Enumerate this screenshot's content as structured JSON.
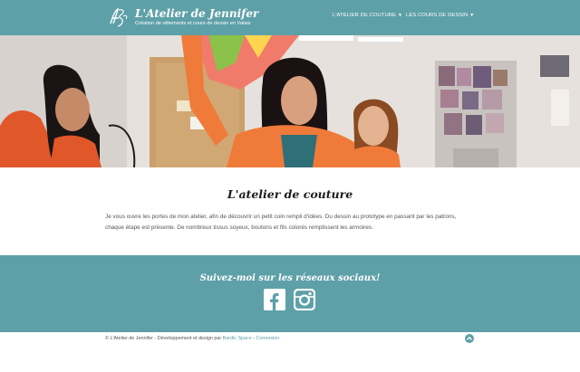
{
  "header": {
    "title": "L'Atelier de Jennifer",
    "tagline": "Création de vêtements et cours de dessin en Valais",
    "logo_icon": "monogram-logo-icon",
    "nav": [
      {
        "label": "L'ATELIER DE COUTURE",
        "icon": "caret-down-icon"
      },
      {
        "label": "LES COURS DE DESSIN",
        "icon": "caret-down-icon"
      }
    ]
  },
  "main": {
    "title": "L'atelier de couture",
    "paragraph": "Je vous ouvre les portes de mon atelier, afin de découvrir un petit coin rempli d'idées. Du dessin au prototype en passant par les patrons, chaque étape est présente. De nombreux tissus soyeux, boutons et fils colorés remplissent les armoires."
  },
  "social": {
    "title": "Suivez-moi sur les réseaux sociaux!",
    "icons": [
      "facebook-icon",
      "instagram-icon"
    ]
  },
  "footer": {
    "text": "© L'Atelier de Jennifer - Développement et design par",
    "credit_link": "Bardic Space",
    "separator": " - ",
    "login_link": "Connexion",
    "back_to_top_icon": "chevron-up-icon"
  },
  "colors": {
    "primary": "#5ea0a8",
    "text": "#555555",
    "heading": "#1c1c1c"
  }
}
